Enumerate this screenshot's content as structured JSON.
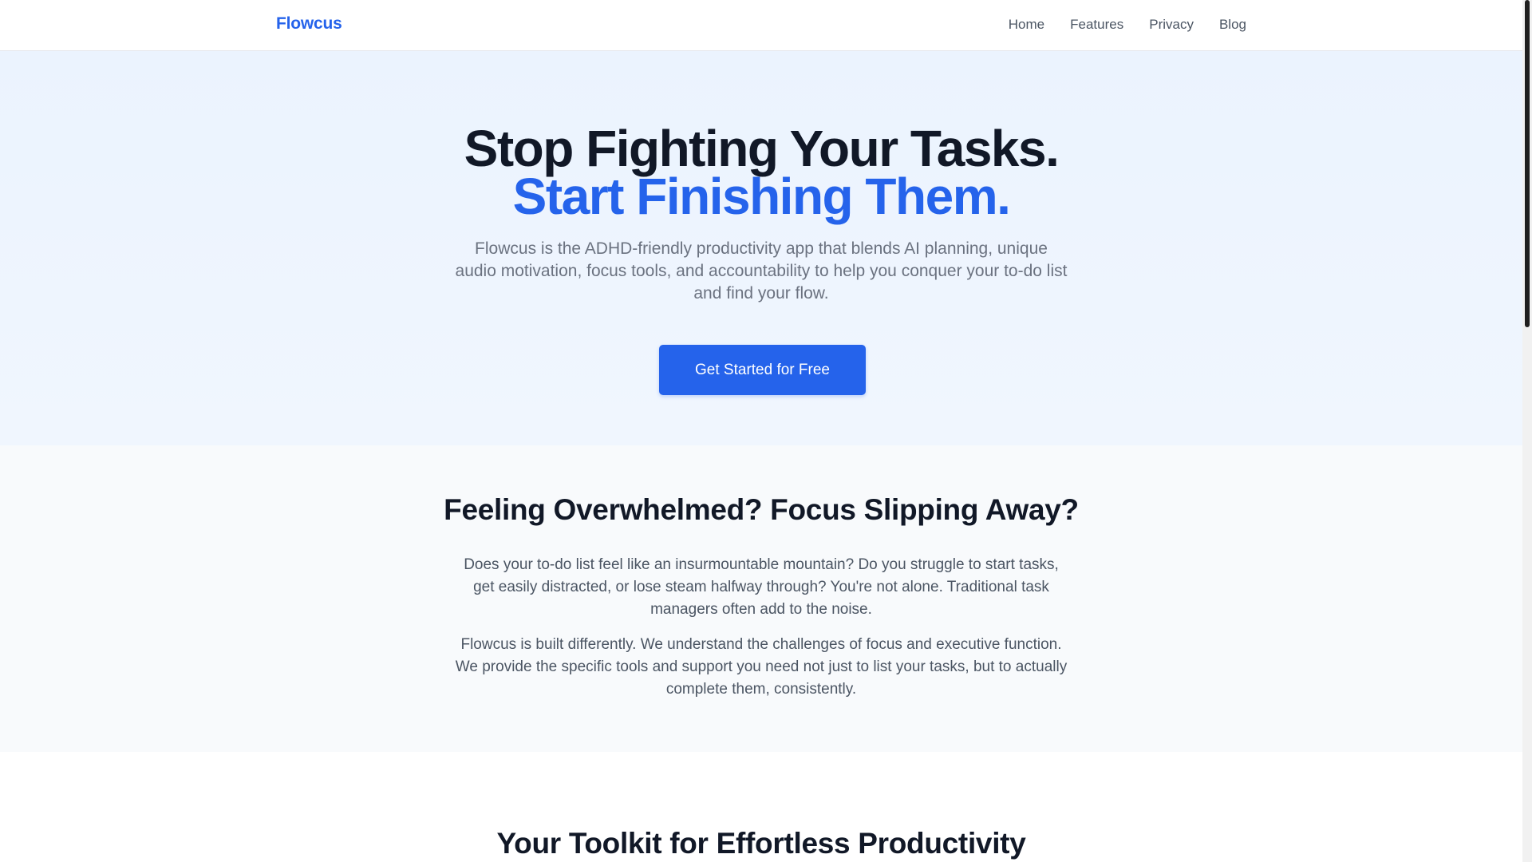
{
  "header": {
    "brand": "Flowcus",
    "nav": [
      "Home",
      "Features",
      "Privacy",
      "Blog"
    ]
  },
  "hero": {
    "title_line1": "Stop Fighting Your Tasks.",
    "title_line2": "Start Finishing Them.",
    "subtitle": "Flowcus is the ADHD-friendly productivity app that blends AI planning, unique audio motivation, focus tools, and accountability to help you conquer your to-do list and find your flow.",
    "cta_label": "Get Started for Free"
  },
  "problem": {
    "title": "Feeling Overwhelmed? Focus Slipping Away?",
    "paragraph1": "Does your to-do list feel like an insurmountable mountain? Do you struggle to start tasks, get easily distracted, or lose steam halfway through? You're not alone. Traditional task managers often add to the noise.",
    "paragraph2": "Flowcus is built differently. We understand the challenges of focus and executive function. We provide the specific tools and support you need not just to list your tasks, but to actually complete them, consistently."
  },
  "toolkit": {
    "title": "Your Toolkit for Effortless Productivity"
  },
  "colors": {
    "accent": "#2563eb",
    "heading": "#111827",
    "hero_bg": "#ebf3fe",
    "section_bg": "#f8fafc"
  }
}
